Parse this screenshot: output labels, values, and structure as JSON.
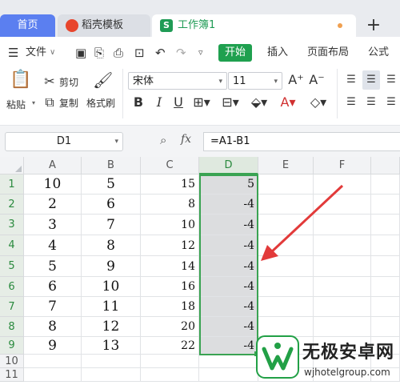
{
  "tabs": {
    "home": "首页",
    "template": "稻壳模板",
    "workbook": "工作簿1",
    "workbook_dot_color": "#f0a050",
    "new_tab": "+"
  },
  "menu": {
    "file": "文件",
    "start": "开始",
    "insert": "插入",
    "page_layout": "页面布局",
    "formula": "公式"
  },
  "ribbon": {
    "paste": "粘贴",
    "cut": "剪切",
    "copy": "复制",
    "format_painter": "格式刷",
    "font_name": "宋体",
    "font_size": "11",
    "bold": "B",
    "italic": "I",
    "underline": "U",
    "grow_font": "A⁺",
    "shrink_font": "A⁻"
  },
  "formula_bar": {
    "cell_ref": "D1",
    "fx": "fx",
    "formula": "=A1-B1"
  },
  "sheet": {
    "columns": [
      "A",
      "B",
      "C",
      "D",
      "E",
      "F"
    ],
    "rows": [
      "1",
      "2",
      "3",
      "4",
      "5",
      "6",
      "7",
      "8",
      "9",
      "10",
      "11"
    ],
    "data": [
      [
        "10",
        "5",
        "15",
        "5"
      ],
      [
        "2",
        "6",
        "8",
        "-4"
      ],
      [
        "3",
        "7",
        "10",
        "-4"
      ],
      [
        "4",
        "8",
        "12",
        "-4"
      ],
      [
        "5",
        "9",
        "14",
        "-4"
      ],
      [
        "6",
        "10",
        "16",
        "-4"
      ],
      [
        "7",
        "11",
        "18",
        "-4"
      ],
      [
        "8",
        "12",
        "20",
        "-4"
      ],
      [
        "9",
        "13",
        "22",
        "-4"
      ]
    ],
    "selection_color": "#3aa352",
    "arrow_color": "#e23a3a"
  },
  "watermark": {
    "title": "无极安卓网",
    "url": "wjhotelgroup.com"
  }
}
